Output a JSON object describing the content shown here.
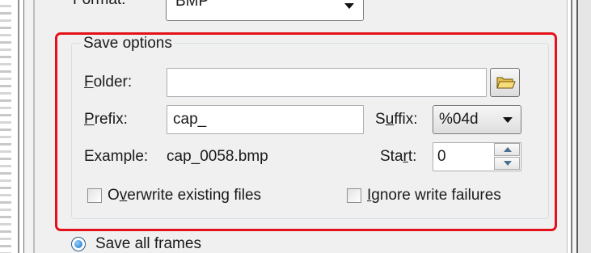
{
  "format": {
    "label": "Format:",
    "value": "BMP"
  },
  "save_options": {
    "title": "Save options",
    "folder": {
      "label": "Folder:",
      "value": ""
    },
    "prefix": {
      "label": "Prefix:",
      "value": "cap_"
    },
    "suffix": {
      "label": "Suffix:",
      "value": "%04d"
    },
    "example": {
      "label": "Example:",
      "value": "cap_0058.bmp"
    },
    "start": {
      "label": "Start:",
      "value": "0"
    },
    "overwrite": {
      "label": "Overwrite existing files",
      "checked": false
    },
    "ignore": {
      "label": "Ignore write failures",
      "checked": false
    }
  },
  "save_all_frames": {
    "label": "Save all frames",
    "selected": true
  },
  "colors": {
    "highlight": "#e3111b",
    "panel": "#f0f0f0"
  }
}
